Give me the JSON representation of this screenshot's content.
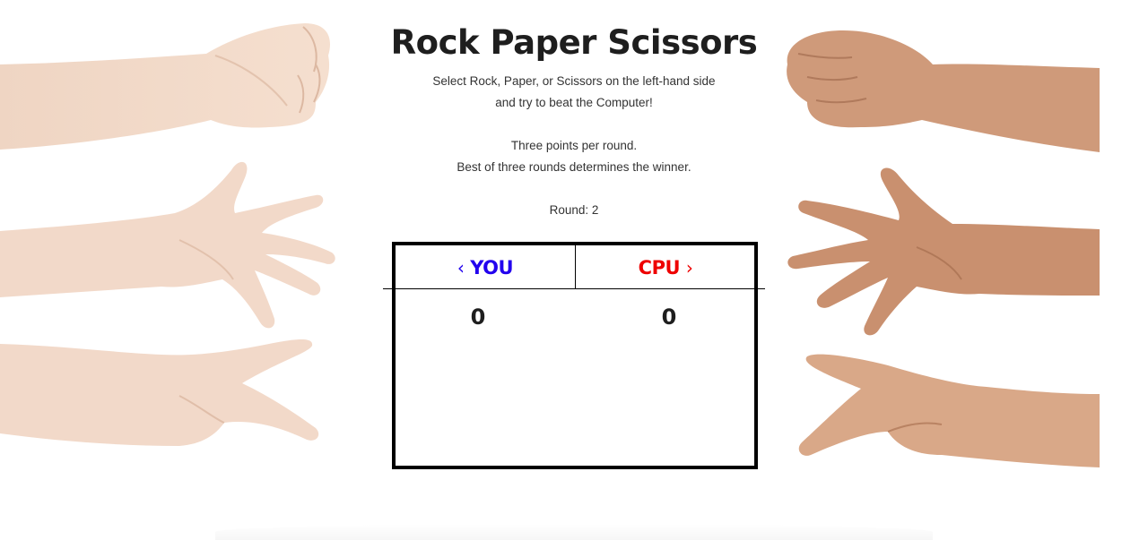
{
  "game": {
    "title": "Rock Paper Scissors",
    "instructions": [
      "Select Rock, Paper, or Scissors on the left-hand side",
      "and try to beat the Computer!",
      "Three points per round.",
      "Best of three rounds determines the winner."
    ],
    "round_label": "Round: 2"
  },
  "scoreboard": {
    "you": {
      "arrow": "‹",
      "label": "YOU",
      "score": "0",
      "color": "#2200ee"
    },
    "cpu": {
      "arrow": "›",
      "label": "CPU",
      "score": "0",
      "color": "#ee0000"
    }
  },
  "hands": {
    "player": [
      "rock-hand-icon",
      "paper-hand-icon",
      "scissors-hand-icon"
    ],
    "computer": [
      "rock-hand-icon",
      "paper-hand-icon",
      "scissors-hand-icon"
    ],
    "player_skin": "#f0d4c0",
    "computer_skin": "#c98f6e"
  }
}
